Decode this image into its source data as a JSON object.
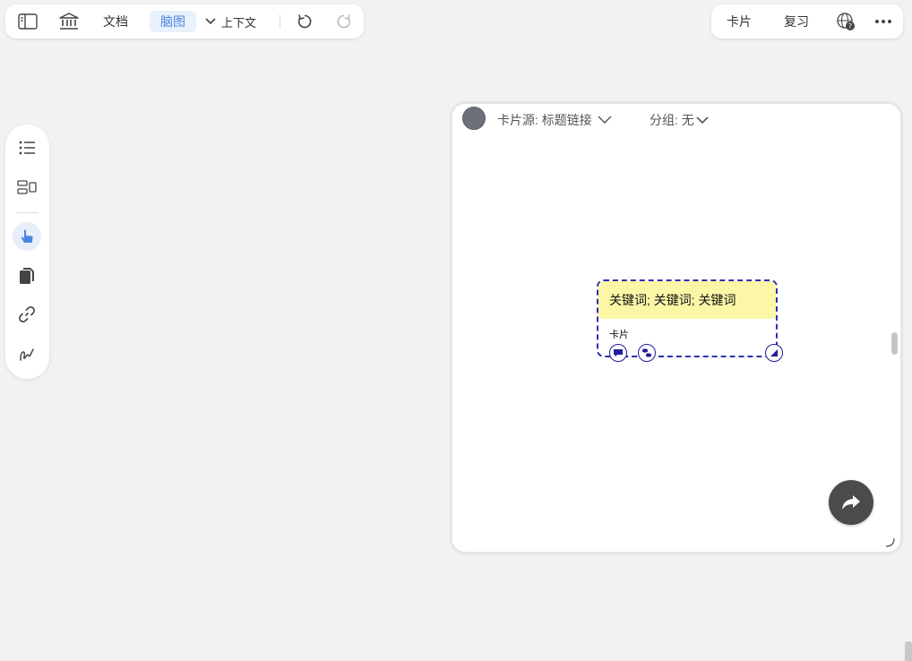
{
  "toolbar_left": {
    "doc_tab": "文档",
    "mindmap_tab": "脑图",
    "context_label": "上下文"
  },
  "toolbar_right": {
    "card_label": "卡片",
    "review_label": "复习"
  },
  "side_toolbar": {
    "icons": [
      "list-icon",
      "layout-icon",
      "pointer-hand-icon",
      "copy-docs-icon",
      "link-icon",
      "freehand-icon"
    ],
    "active": "pointer-hand-icon"
  },
  "card_window": {
    "source_label": "卡片源: 标题链接",
    "group_label": "分组: 无",
    "card": {
      "title": "关键词; 关键词; 关键词",
      "body": "卡片",
      "title_bg": "#fbf7a6",
      "border_color": "#2f2fb3"
    }
  },
  "colors": {
    "accent": "#4a86e0",
    "background": "#f2f2f2"
  }
}
